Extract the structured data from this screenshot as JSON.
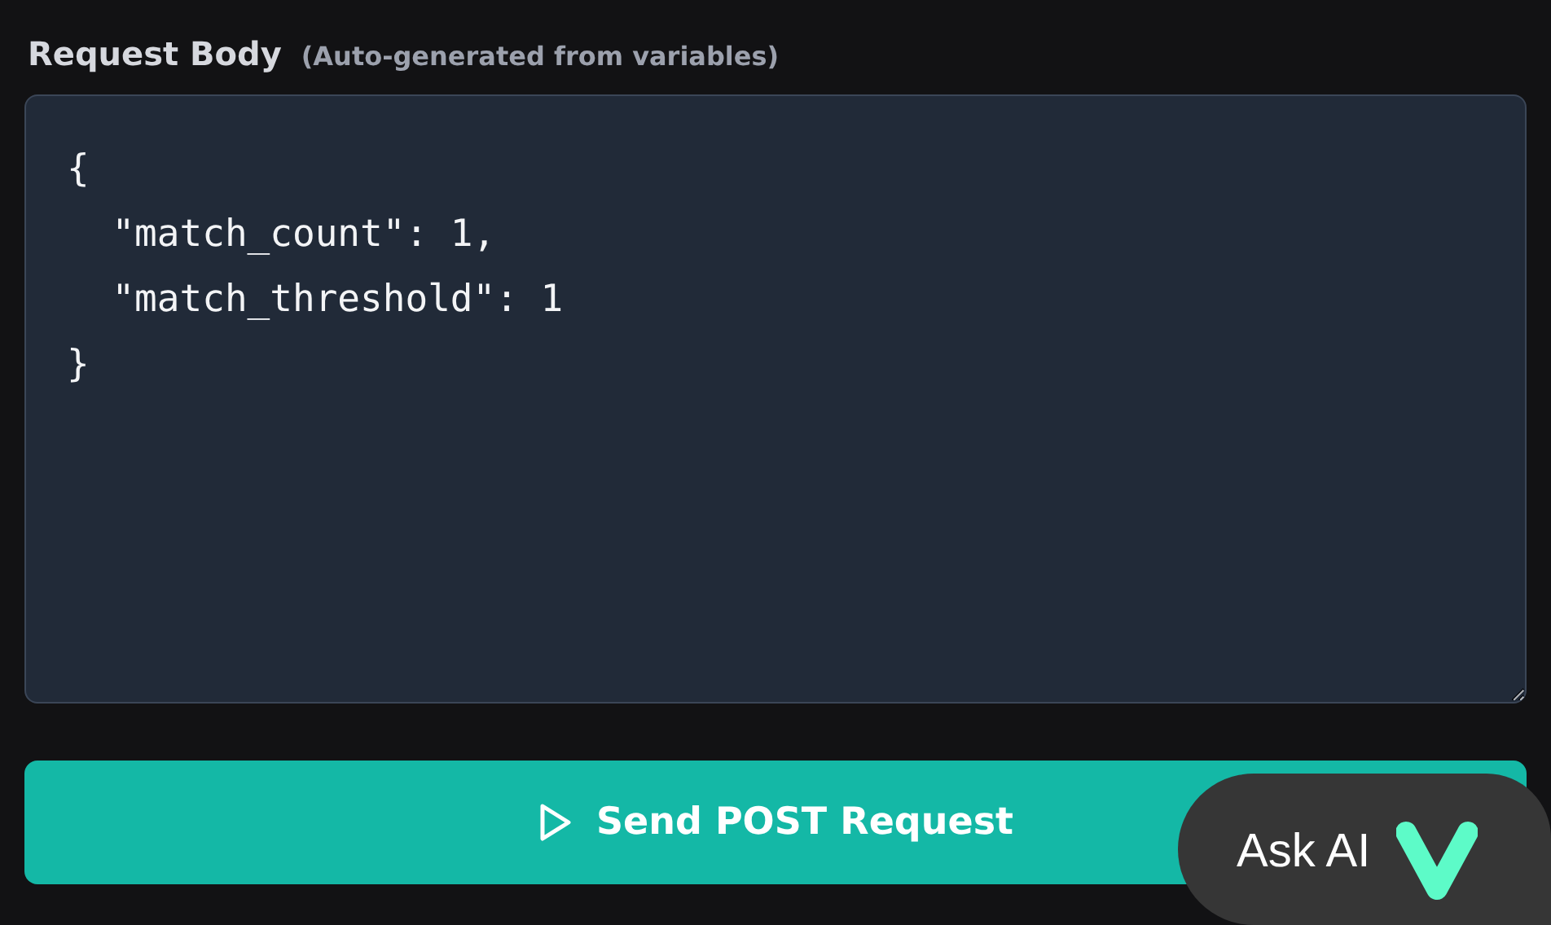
{
  "request_body": {
    "title": "Request Body",
    "hint": "(Auto-generated from variables)",
    "value": "{\n  \"match_count\": 1,\n  \"match_threshold\": 1\n}"
  },
  "send_button": {
    "label": "Send POST Request"
  },
  "ask_ai": {
    "label": "Ask AI"
  }
}
